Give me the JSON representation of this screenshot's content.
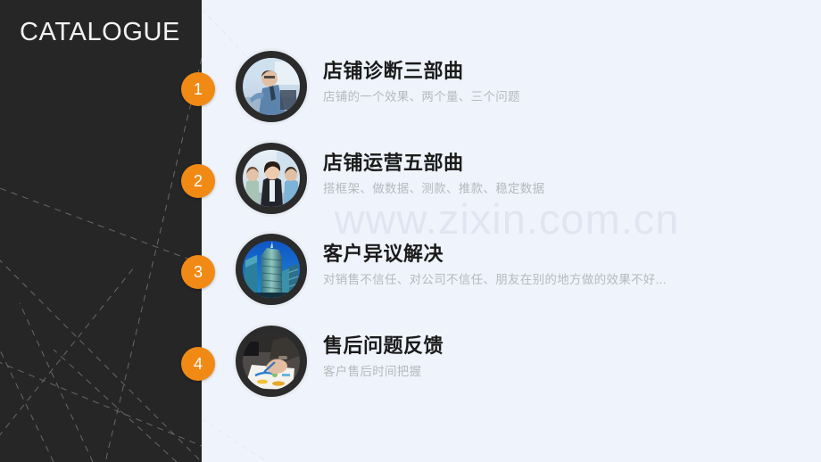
{
  "slide": {
    "title": "CATALOGUE",
    "background_color": "#eff4fc",
    "panel_color": "#262626",
    "accent_color": "#f18a15",
    "watermark": "www.zixin.com.cn"
  },
  "items": [
    {
      "number": "1",
      "heading": "店铺诊断三部曲",
      "subtitle": "店铺的一个效果、两个量、三个问题",
      "image_name": "businessperson-pointing-photo"
    },
    {
      "number": "2",
      "heading": "店铺运营五部曲",
      "subtitle": "搭框架、做数据、测款、推款、稳定数据",
      "image_name": "business-team-walking-photo"
    },
    {
      "number": "3",
      "heading": "客户异议解决",
      "subtitle": "对销售不信任、对公司不信任、朋友在别的地方做的效果不好...",
      "image_name": "city-skyscrapers-photo"
    },
    {
      "number": "4",
      "heading": "售后问题反馈",
      "subtitle": "客户售后时间把握",
      "image_name": "hands-writing-on-charts-photo"
    }
  ]
}
